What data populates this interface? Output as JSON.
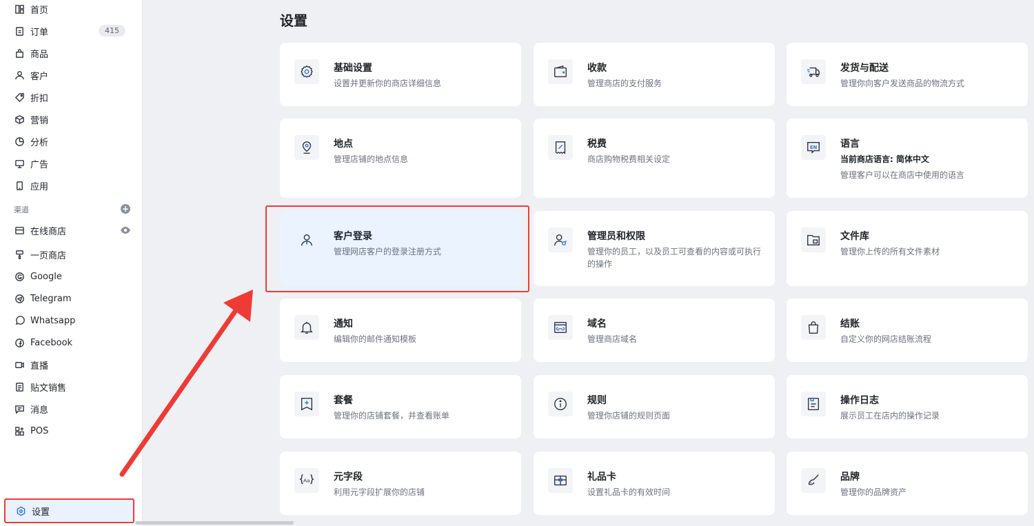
{
  "sidebar": {
    "items": [
      {
        "label": "首页",
        "icon": "home-icon"
      },
      {
        "label": "订单",
        "icon": "order-icon",
        "badge": "415"
      },
      {
        "label": "商品",
        "icon": "bag-icon"
      },
      {
        "label": "客户",
        "icon": "user-icon"
      },
      {
        "label": "折扣",
        "icon": "tag-icon"
      },
      {
        "label": "营销",
        "icon": "cube-icon"
      },
      {
        "label": "分析",
        "icon": "pie-icon"
      },
      {
        "label": "广告",
        "icon": "monitor-icon"
      },
      {
        "label": "应用",
        "icon": "phone-icon"
      }
    ],
    "channels_label": "渠道",
    "channels": [
      {
        "label": "在线商店",
        "icon": "store-icon"
      },
      {
        "label": "一页商店",
        "icon": "brush-icon"
      },
      {
        "label": "Google",
        "icon": "google-icon"
      },
      {
        "label": "Telegram",
        "icon": "telegram-icon"
      },
      {
        "label": "Whatsapp",
        "icon": "whatsapp-icon"
      },
      {
        "label": "Facebook",
        "icon": "facebook-icon"
      },
      {
        "label": "直播",
        "icon": "video-icon"
      },
      {
        "label": "贴文销售",
        "icon": "post-icon"
      },
      {
        "label": "消息",
        "icon": "message-icon"
      },
      {
        "label": "POS",
        "icon": "pos-icon"
      }
    ],
    "settings_label": "设置"
  },
  "main": {
    "title": "设置",
    "cards": [
      {
        "title": "基础设置",
        "desc": "设置并更新你的商店详细信息",
        "icon": "gear-icon"
      },
      {
        "title": "收款",
        "desc": "管理商店的支付服务",
        "icon": "wallet-icon"
      },
      {
        "title": "发货与配送",
        "desc": "管理你向客户发送商品的物流方式",
        "icon": "truck-icon"
      },
      {
        "title": "地点",
        "desc": "管理店铺的地点信息",
        "icon": "location-icon"
      },
      {
        "title": "税费",
        "desc": "商店购物税费相关设定",
        "icon": "receipt-icon"
      },
      {
        "title": "语言",
        "sub": "当前商店语言: 简体中文",
        "desc": "管理客户可以在商店中使用的语言",
        "icon": "language-icon"
      },
      {
        "title": "客户登录",
        "desc": "管理网店客户的登录注册方式",
        "icon": "customer-login-icon"
      },
      {
        "title": "管理员和权限",
        "desc": "管理你的员工，以及员工可查看的内容或可执行的操作",
        "icon": "admin-icon"
      },
      {
        "title": "文件库",
        "desc": "管理你上传的所有文件素材",
        "icon": "folder-icon"
      },
      {
        "title": "通知",
        "desc": "编辑你的邮件通知模板",
        "icon": "bell-icon"
      },
      {
        "title": "域名",
        "desc": "管理商店域名",
        "icon": "domain-icon"
      },
      {
        "title": "结账",
        "desc": "自定义你的网店结账流程",
        "icon": "checkout-icon"
      },
      {
        "title": "套餐",
        "desc": "管理你的店铺套餐，并查看账单",
        "icon": "plan-icon"
      },
      {
        "title": "规则",
        "desc": "管理你店铺的规则页面",
        "icon": "info-icon"
      },
      {
        "title": "操作日志",
        "desc": "展示员工在店内的操作记录",
        "icon": "log-icon"
      },
      {
        "title": "元字段",
        "desc": "利用元字段扩展你的店铺",
        "icon": "metafield-icon"
      },
      {
        "title": "礼品卡",
        "desc": "设置礼品卡的有效时间",
        "icon": "gift-card-icon"
      },
      {
        "title": "品牌",
        "desc": "管理你的品牌资产",
        "icon": "brand-icon"
      }
    ]
  },
  "colors": {
    "accent": "#2f6fed",
    "highlight": "#ef3b36",
    "background": "#eef0f3"
  }
}
